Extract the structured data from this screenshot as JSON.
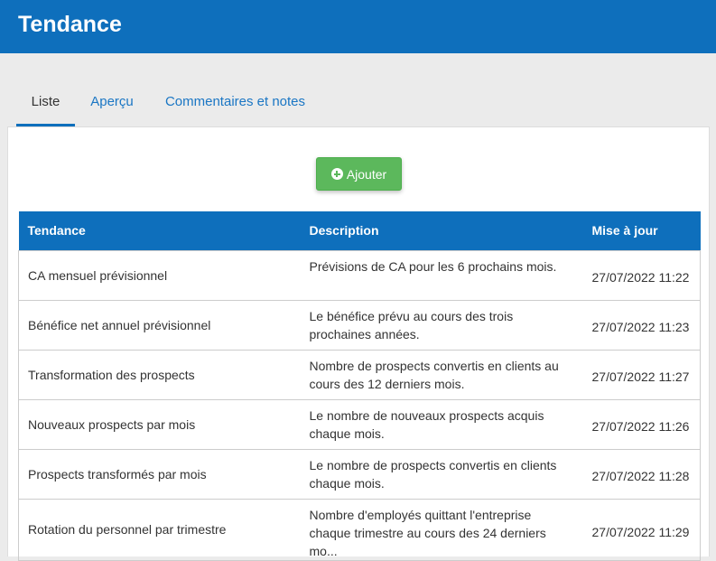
{
  "header": {
    "title": "Tendance",
    "bg_color": "#0e6fbc"
  },
  "tabs": [
    {
      "label": "Liste",
      "active": true
    },
    {
      "label": "Aperçu",
      "active": false
    },
    {
      "label": "Commentaires et notes",
      "active": false
    }
  ],
  "toolbar": {
    "add_label": "Ajouter",
    "add_icon": "plus-circle-icon",
    "add_color": "#5cb85c"
  },
  "table": {
    "columns": [
      "Tendance",
      "Description",
      "Mise à jour"
    ],
    "rows": [
      {
        "name": "CA mensuel prévisionnel",
        "description": "Prévisions de CA pour les 6 prochains mois.",
        "updated": "27/07/2022 11:22"
      },
      {
        "name": "Bénéfice net annuel prévisionnel",
        "description": "Le bénéfice prévu au cours des trois prochaines années.",
        "updated": "27/07/2022 11:23"
      },
      {
        "name": "Transformation des prospects",
        "description": "Nombre de prospects convertis en clients au cours des 12 derniers mois.",
        "updated": "27/07/2022 11:27"
      },
      {
        "name": "Nouveaux prospects par mois",
        "description": "Le nombre de nouveaux prospects acquis chaque mois.",
        "updated": "27/07/2022 11:26"
      },
      {
        "name": "Prospects transformés par mois",
        "description": "Le nombre de prospects convertis en clients chaque mois.",
        "updated": "27/07/2022 11:28"
      },
      {
        "name": "Rotation du personnel par trimestre",
        "description": "Nombre d'employés quittant l'entreprise chaque trimestre au cours des 24 derniers mo...",
        "updated": "27/07/2022 11:29"
      }
    ]
  }
}
